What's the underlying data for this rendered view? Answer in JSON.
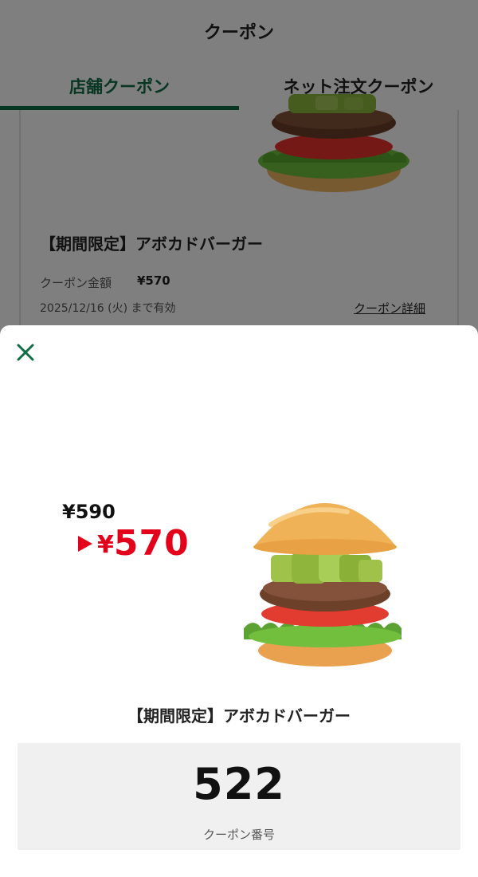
{
  "header": {
    "title": "クーポン"
  },
  "tabs": [
    {
      "label": "店舗クーポン",
      "active": true
    },
    {
      "label": "ネット注文クーポン",
      "active": false
    }
  ],
  "coupon_card": {
    "title": "【期間限定】アボカドバーガー",
    "amount_label": "クーポン金額",
    "amount_value": "¥570",
    "valid_until": "2025/12/16 (火) まで有効",
    "detail_link": "クーポン詳細"
  },
  "sheet": {
    "close_icon": "close-icon",
    "price_old": "¥590",
    "price_new_yen": "¥",
    "price_new": "570",
    "title": "【期間限定】アボカドバーガー",
    "coupon_number": "522",
    "coupon_number_label": "クーポン番号"
  },
  "colors": {
    "brand_green": "#0f6d45",
    "price_red": "#e3001b",
    "code_box_bg": "#f0f0f0"
  }
}
